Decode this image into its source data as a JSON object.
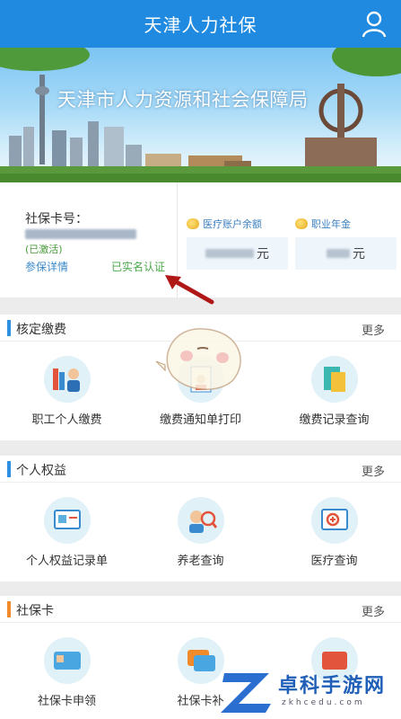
{
  "header": {
    "title": "天津人力社保"
  },
  "banner": {
    "title": "天津市人力资源和社会保障局"
  },
  "card": {
    "label": "社保卡号：",
    "activated": "(已激活)",
    "detail_link": "参保详情",
    "verified": "已实名认证",
    "medical_label": "医疗账户余额",
    "pension_label": "职业年金",
    "unit": "元"
  },
  "sections": [
    {
      "title": "核定缴费",
      "more": "更多",
      "accent": "#2f8fe0",
      "items": [
        {
          "label": "职工个人缴费",
          "icon": "worker-icon"
        },
        {
          "label": "缴费通知单打印",
          "icon": "print-notice-icon"
        },
        {
          "label": "缴费记录查询",
          "icon": "record-query-icon"
        }
      ]
    },
    {
      "title": "个人权益",
      "more": "更多",
      "accent": "#2f8fe0",
      "items": [
        {
          "label": "个人权益记录单",
          "icon": "rights-record-icon"
        },
        {
          "label": "养老查询",
          "icon": "pension-query-icon"
        },
        {
          "label": "医疗查询",
          "icon": "medical-query-icon"
        }
      ]
    },
    {
      "title": "社保卡",
      "more": "更多",
      "accent": "#f08a2a",
      "items": [
        {
          "label": "社保卡申领",
          "icon": "card-apply-icon"
        },
        {
          "label": "社保卡补",
          "icon": "card-reissue-icon"
        },
        {
          "label": "",
          "icon": "card-other-icon"
        }
      ]
    }
  ],
  "watermark": {
    "text": "卓科手游网",
    "sub": "zkhcedu.com"
  }
}
